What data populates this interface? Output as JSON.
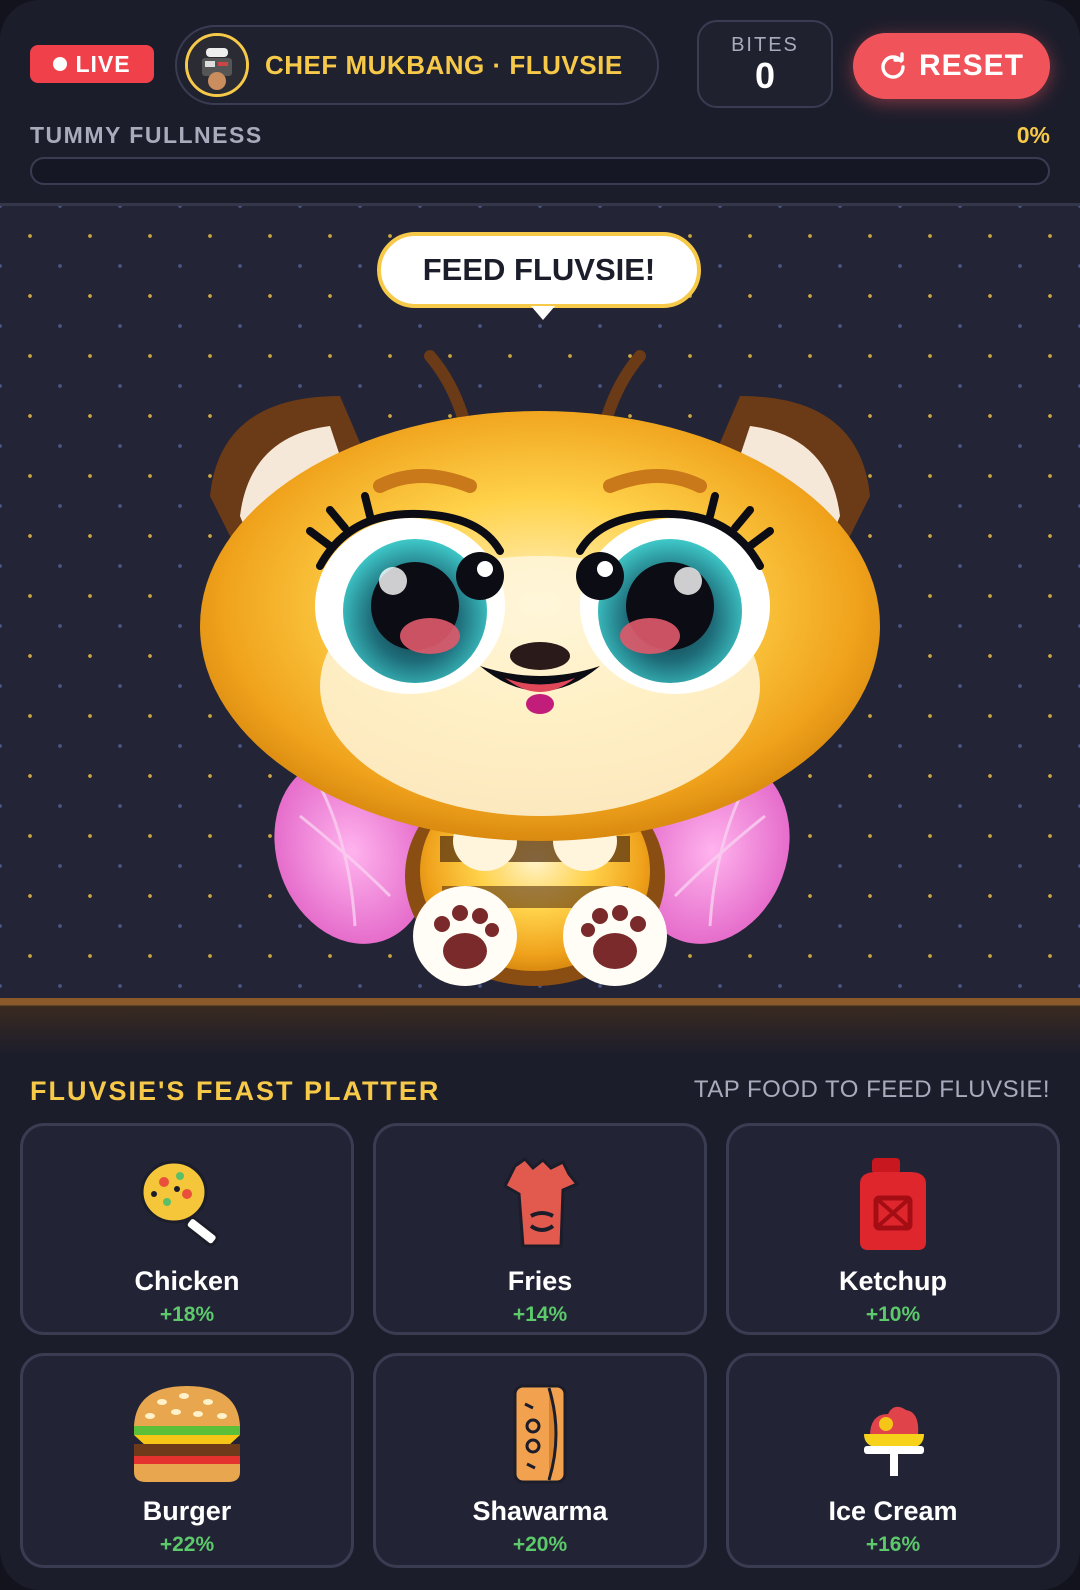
{
  "header": {
    "live_label": "LIVE",
    "channel_name": "CHEF MUKBANG · FLUVSIE",
    "bites_label": "BITES",
    "bites_value": "0",
    "reset_label": "RESET"
  },
  "fullness": {
    "label": "TUMMY FULLNESS",
    "value_text": "0%",
    "value": 0
  },
  "stage": {
    "speech": "FEED FLUVSIE!"
  },
  "platter": {
    "title": "FLUVSIE'S FEAST PLATTER",
    "hint": "TAP FOOD TO FEED FLUVSIE!",
    "items": [
      {
        "name": "Chicken",
        "bonus": "+18%",
        "icon": "chicken-icon"
      },
      {
        "name": "Fries",
        "bonus": "+14%",
        "icon": "fries-icon"
      },
      {
        "name": "Ketchup",
        "bonus": "+10%",
        "icon": "ketchup-icon"
      },
      {
        "name": "Burger",
        "bonus": "+22%",
        "icon": "burger-icon"
      },
      {
        "name": "Shawarma",
        "bonus": "+20%",
        "icon": "shawarma-icon"
      },
      {
        "name": "Ice Cream",
        "bonus": "+16%",
        "icon": "ice-cream-icon"
      }
    ]
  },
  "colors": {
    "accent": "#f7c948",
    "live": "#f0414a",
    "reset": "#f0545a",
    "bonus": "#5cc96b",
    "background": "#1c1d2b"
  }
}
